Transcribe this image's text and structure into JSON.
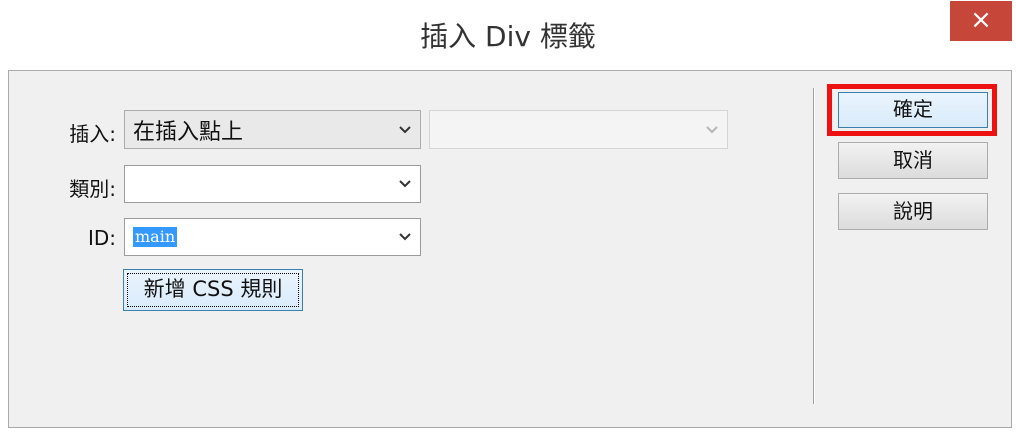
{
  "window": {
    "title": "插入 Div 標籤",
    "close_glyph": "×"
  },
  "form": {
    "insert": {
      "label": "插入:",
      "value": "在插入點上"
    },
    "insert_target": {
      "value": ""
    },
    "class": {
      "label": "類別:",
      "value": ""
    },
    "id": {
      "label": "ID:",
      "value": "main"
    },
    "new_css_rule_label": "新增 CSS 規則"
  },
  "buttons": {
    "ok_label": "確定",
    "cancel_label": "取消",
    "help_label": "說明"
  },
  "colors": {
    "close_button": "#c7463a",
    "highlight": "#ee1111",
    "selection": "#3399ff",
    "dialog_bg": "#f0f0f0"
  },
  "icons": {
    "dropdown": "chevron-down-icon",
    "close": "close-icon"
  }
}
